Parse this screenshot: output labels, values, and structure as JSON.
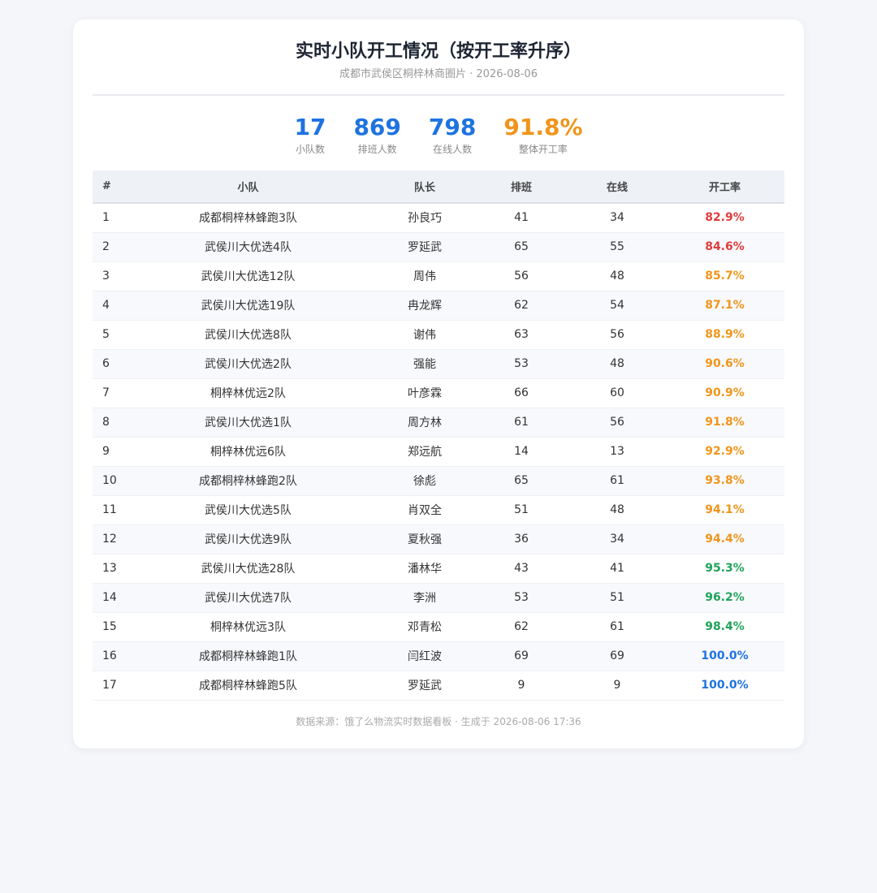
{
  "header": {
    "title": "实时小队开工情况（按开工率升序）",
    "subtitle": "成都市武侯区桐梓林商圈片 · 2026-08-06"
  },
  "stats": [
    {
      "value": "17",
      "label": "小队数",
      "color": "#1f73e0"
    },
    {
      "value": "869",
      "label": "排班人数",
      "color": "#1f73e0"
    },
    {
      "value": "798",
      "label": "在线人数",
      "color": "#1f73e0"
    },
    {
      "value": "91.8%",
      "label": "整体开工率",
      "color": "#f0951b"
    }
  ],
  "table": {
    "headers": [
      "#",
      "小队",
      "队长",
      "排班",
      "在线",
      "开工率"
    ],
    "rows": [
      {
        "idx": "1",
        "team": "成都桐梓林蜂跑3队",
        "leader": "孙良巧",
        "scheduled": "41",
        "online": "34",
        "rate": "82.9%",
        "color": "#e23b3b"
      },
      {
        "idx": "2",
        "team": "武侯川大优选4队",
        "leader": "罗延武",
        "scheduled": "65",
        "online": "55",
        "rate": "84.6%",
        "color": "#e23b3b"
      },
      {
        "idx": "3",
        "team": "武侯川大优选12队",
        "leader": "周伟",
        "scheduled": "56",
        "online": "48",
        "rate": "85.7%",
        "color": "#f0951b"
      },
      {
        "idx": "4",
        "team": "武侯川大优选19队",
        "leader": "冉龙辉",
        "scheduled": "62",
        "online": "54",
        "rate": "87.1%",
        "color": "#f0951b"
      },
      {
        "idx": "5",
        "team": "武侯川大优选8队",
        "leader": "谢伟",
        "scheduled": "63",
        "online": "56",
        "rate": "88.9%",
        "color": "#f0951b"
      },
      {
        "idx": "6",
        "team": "武侯川大优选2队",
        "leader": "强能",
        "scheduled": "53",
        "online": "48",
        "rate": "90.6%",
        "color": "#f0951b"
      },
      {
        "idx": "7",
        "team": "桐梓林优远2队",
        "leader": "叶彦霖",
        "scheduled": "66",
        "online": "60",
        "rate": "90.9%",
        "color": "#f0951b"
      },
      {
        "idx": "8",
        "team": "武侯川大优选1队",
        "leader": "周方林",
        "scheduled": "61",
        "online": "56",
        "rate": "91.8%",
        "color": "#f0951b"
      },
      {
        "idx": "9",
        "team": "桐梓林优远6队",
        "leader": "郑远航",
        "scheduled": "14",
        "online": "13",
        "rate": "92.9%",
        "color": "#f0951b"
      },
      {
        "idx": "10",
        "team": "成都桐梓林蜂跑2队",
        "leader": "徐彪",
        "scheduled": "65",
        "online": "61",
        "rate": "93.8%",
        "color": "#f0951b"
      },
      {
        "idx": "11",
        "team": "武侯川大优选5队",
        "leader": "肖双全",
        "scheduled": "51",
        "online": "48",
        "rate": "94.1%",
        "color": "#f0951b"
      },
      {
        "idx": "12",
        "team": "武侯川大优选9队",
        "leader": "夏秋强",
        "scheduled": "36",
        "online": "34",
        "rate": "94.4%",
        "color": "#f0951b"
      },
      {
        "idx": "13",
        "team": "武侯川大优选28队",
        "leader": "潘林华",
        "scheduled": "43",
        "online": "41",
        "rate": "95.3%",
        "color": "#1fa35a"
      },
      {
        "idx": "14",
        "team": "武侯川大优选7队",
        "leader": "李洲",
        "scheduled": "53",
        "online": "51",
        "rate": "96.2%",
        "color": "#1fa35a"
      },
      {
        "idx": "15",
        "team": "桐梓林优远3队",
        "leader": "邓青松",
        "scheduled": "62",
        "online": "61",
        "rate": "98.4%",
        "color": "#1fa35a"
      },
      {
        "idx": "16",
        "team": "成都桐梓林蜂跑1队",
        "leader": "闫红波",
        "scheduled": "69",
        "online": "69",
        "rate": "100.0%",
        "color": "#1f73e0"
      },
      {
        "idx": "17",
        "team": "成都桐梓林蜂跑5队",
        "leader": "罗延武",
        "scheduled": "9",
        "online": "9",
        "rate": "100.0%",
        "color": "#1f73e0"
      }
    ]
  },
  "footer": {
    "text": "数据来源：饿了么物流实时数据看板 · 生成于 2026-08-06 17:36"
  }
}
